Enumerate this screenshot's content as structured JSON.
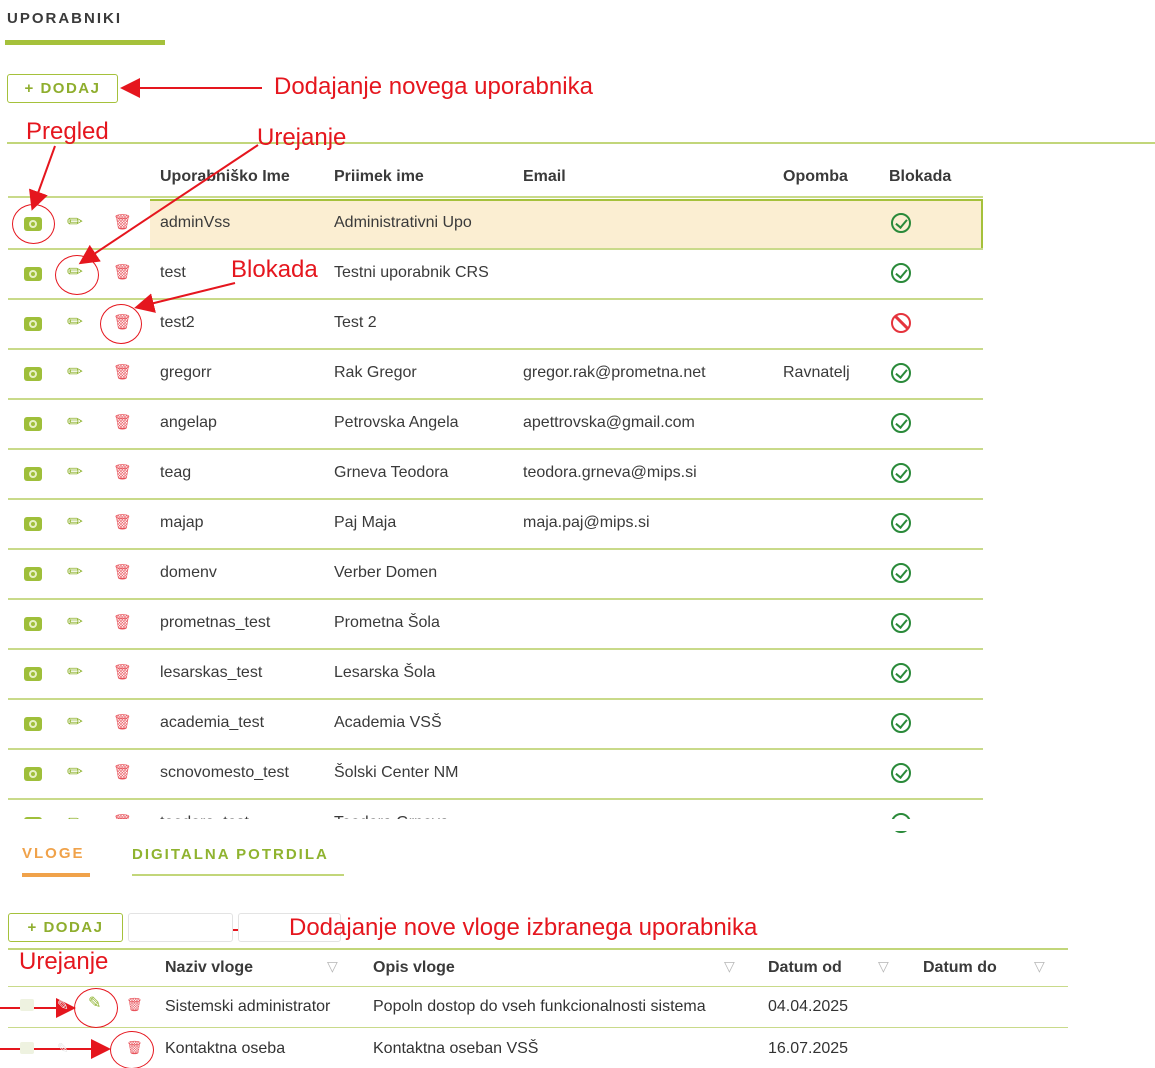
{
  "page": {
    "title": "UPORABNIKI",
    "add_label": "+ DODAJ"
  },
  "users_table": {
    "columns": [
      "Uporabniško Ime",
      "Priimek ime",
      "Email",
      "Opomba",
      "Blokada"
    ],
    "rows": [
      {
        "username": "adminVss",
        "name": "Administrativni Upo",
        "email": "",
        "note": "",
        "blocked": false
      },
      {
        "username": "test",
        "name": "Testni uporabnik CRS",
        "email": "",
        "note": "",
        "blocked": false
      },
      {
        "username": "test2",
        "name": "Test 2",
        "email": "",
        "note": "",
        "blocked": true
      },
      {
        "username": "gregorr",
        "name": "Rak Gregor",
        "email": "gregor.rak@prometna.net",
        "note": "Ravnatelj",
        "blocked": false
      },
      {
        "username": "angelap",
        "name": "Petrovska Angela",
        "email": "apettrovska@gmail.com",
        "note": "",
        "blocked": false
      },
      {
        "username": "teag",
        "name": "Grneva Teodora",
        "email": "teodora.grneva@mips.si",
        "note": "",
        "blocked": false
      },
      {
        "username": "majap",
        "name": "Paj Maja",
        "email": "maja.paj@mips.si",
        "note": "",
        "blocked": false
      },
      {
        "username": "domenv",
        "name": "Verber Domen",
        "email": "",
        "note": "",
        "blocked": false
      },
      {
        "username": "prometnas_test",
        "name": "Prometna Šola",
        "email": "",
        "note": "",
        "blocked": false
      },
      {
        "username": "lesarskas_test",
        "name": "Lesarska Šola",
        "email": "",
        "note": "",
        "blocked": false
      },
      {
        "username": "academia_test",
        "name": "Academia VSŠ",
        "email": "",
        "note": "",
        "blocked": false
      },
      {
        "username": "scnovomesto_test",
        "name": "Šolski Center NM",
        "email": "",
        "note": "",
        "blocked": false
      },
      {
        "username": "teodora_test",
        "name": "Teodora Grneva",
        "email": "",
        "note": "",
        "blocked": false
      }
    ]
  },
  "tabs": {
    "roles": "VLOGE",
    "certificates": "DIGITALNA POTRDILA"
  },
  "roles_section": {
    "add_label": "+ DODAJ",
    "columns": [
      "Naziv vloge",
      "Opis vloge",
      "Datum od",
      "Datum do"
    ],
    "rows": [
      {
        "name": "Sistemski administrator",
        "description": "Popoln dostop do vseh funkcionalnosti sistema",
        "date_from": "04.04.2025",
        "date_to": ""
      },
      {
        "name": "Kontaktna oseba",
        "description": "Kontaktna oseban VSŠ",
        "date_from": "16.07.2025",
        "date_to": ""
      }
    ]
  },
  "annotations": {
    "add_user": "Dodajanje novega uporabnika",
    "view": "Pregled",
    "edit": "Urejanje",
    "block": "Blokada",
    "add_role": "Dodajanje nove vloge izbranega uporabnika",
    "edit_role": "Urejanje"
  },
  "icons": {
    "view": "eye-icon",
    "edit": "pencil-icon",
    "delete": "trash-icon",
    "not_blocked": "check-circle-icon",
    "blocked": "block-icon",
    "filter": "filter-icon"
  },
  "colors": {
    "accent_green": "#a5c13b",
    "tab_active": "#f0a24a",
    "annotation_red": "#e5161e",
    "delete_red": "#e8535b",
    "check_green": "#2a8a3a",
    "selected_row_bg": "#fbeed2"
  }
}
